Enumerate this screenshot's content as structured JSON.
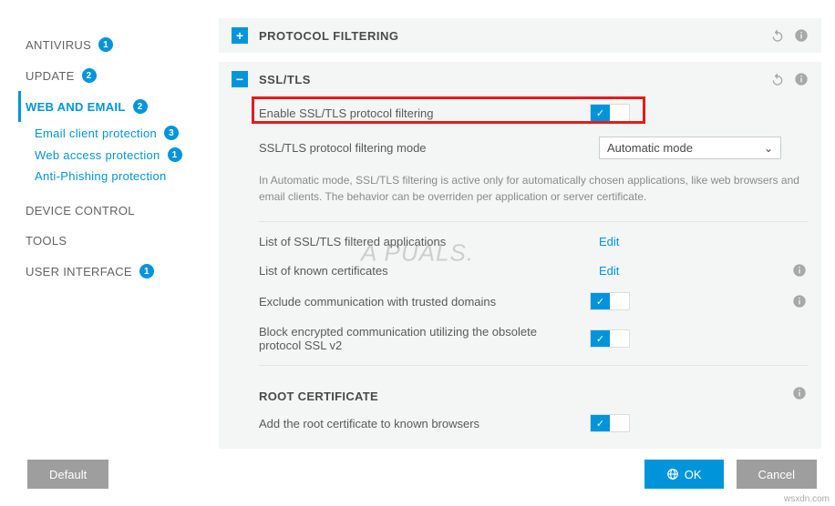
{
  "sidebar": {
    "items": [
      {
        "label": "ANTIVIRUS",
        "badge": "1",
        "type": "top"
      },
      {
        "label": "UPDATE",
        "badge": "2",
        "type": "top"
      },
      {
        "label": "WEB AND EMAIL",
        "badge": "2",
        "type": "top-active"
      },
      {
        "label": "Email client protection",
        "badge": "3",
        "type": "sub"
      },
      {
        "label": "Web access protection",
        "badge": "1",
        "type": "sub"
      },
      {
        "label": "Anti-Phishing protection",
        "badge": "",
        "type": "sub"
      },
      {
        "label": "DEVICE CONTROL",
        "badge": "",
        "type": "top"
      },
      {
        "label": "TOOLS",
        "badge": "",
        "type": "top"
      },
      {
        "label": "USER INTERFACE",
        "badge": "1",
        "type": "top"
      }
    ]
  },
  "panels": {
    "protocol": {
      "title": "PROTOCOL FILTERING"
    },
    "ssltls": {
      "title": "SSL/TLS",
      "enable_label": "Enable SSL/TLS protocol filtering",
      "mode_label": "SSL/TLS protocol filtering mode",
      "mode_value": "Automatic mode",
      "help": "In Automatic mode, SSL/TLS filtering is active only for automatically chosen applications, like web browsers and email clients. The behavior can be overriden per application or server certificate.",
      "apps_label": "List of SSL/TLS filtered applications",
      "certs_label": "List of known certificates",
      "edit": "Edit",
      "exclude_label": "Exclude communication with trusted domains",
      "block_label": "Block encrypted communication utilizing the obsolete protocol SSL v2",
      "root_title": "ROOT CERTIFICATE",
      "root_add_label": "Add the root certificate to known browsers"
    }
  },
  "footer": {
    "default": "Default",
    "ok": "OK",
    "cancel": "Cancel"
  },
  "watermark": "A   PUALS.",
  "corner": "wsxdn.com"
}
